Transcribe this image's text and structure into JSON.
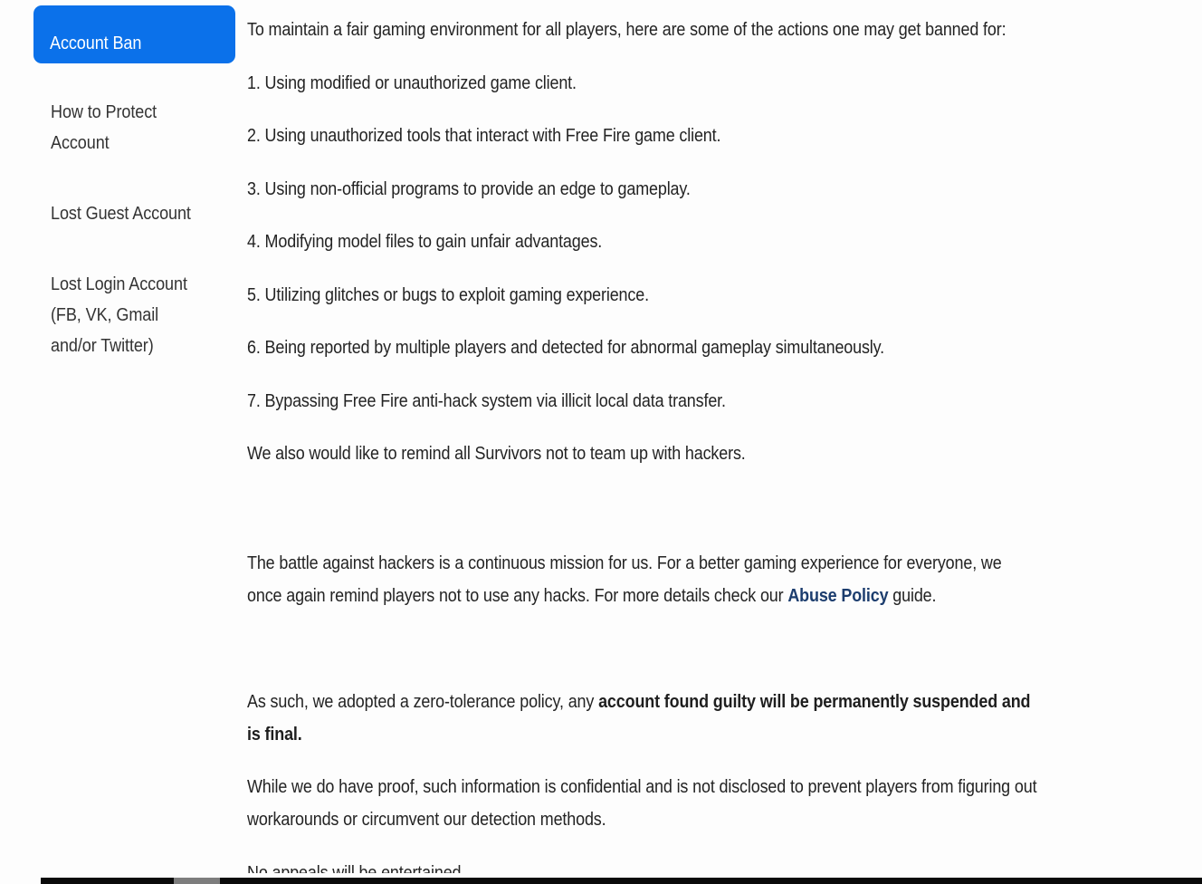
{
  "sidebar": {
    "items": [
      {
        "id": "account-ban",
        "label": "Account Ban",
        "active": true
      },
      {
        "id": "how-to-protect-account",
        "label": "How to Protect\nAccount",
        "active": false
      },
      {
        "id": "lost-guest-account",
        "label": "Lost Guest Account",
        "active": false
      },
      {
        "id": "lost-login-account",
        "label": "Lost Login Account\n(FB, VK, Gmail\nand/or Twitter)",
        "active": false
      }
    ],
    "active_bg_color": "#0b71ea",
    "active_text_color": "#ffffff",
    "item_text_color": "#333333"
  },
  "content": {
    "intro": "To maintain a fair gaming environment for all players, here are some of the actions one may get banned for:",
    "rules": [
      "1. Using modified or unauthorized game client.",
      "2. Using unauthorized tools that interact with Free Fire game client.",
      "3. Using non-official programs to provide an edge to gameplay.",
      "4. Modifying model files to gain unfair advantages.",
      "5. Utilizing glitches or bugs to exploit gaming experience.",
      "6. Being reported by multiple players and detected for abnormal gameplay simultaneously.",
      "7. Bypassing Free Fire anti-hack system via illicit local data transfer."
    ],
    "reminder": "We also would like to remind all Survivors not to team up with hackers.",
    "battle_paragraph": {
      "before_link": "The battle against hackers is a continuous mission for us. For a better gaming experience for everyone, we once again remind players not to use any hacks. For more details check our ",
      "link_label": "Abuse Policy",
      "link_color": "#1c3d6e",
      "after_link": " guide."
    },
    "zero_tolerance": {
      "before_bold": "As such, we adopted a zero-tolerance policy, any ",
      "bold_text": "account found guilty will be permanently suspended and is final.",
      "after_bold": ""
    },
    "proof_paragraph": "While we do have proof, such information is confidential and is not disclosed to prevent players from figuring out workarounds or circumvent our detection methods.",
    "no_appeals": "No appeals will be entertained.",
    "text_color": "#232323"
  },
  "scrollbar": {
    "orientation": "horizontal",
    "track_color": "#0a0a0a",
    "thumb_color": "#7d7d7d"
  },
  "page": {
    "background_color": "#fdfdfd"
  }
}
